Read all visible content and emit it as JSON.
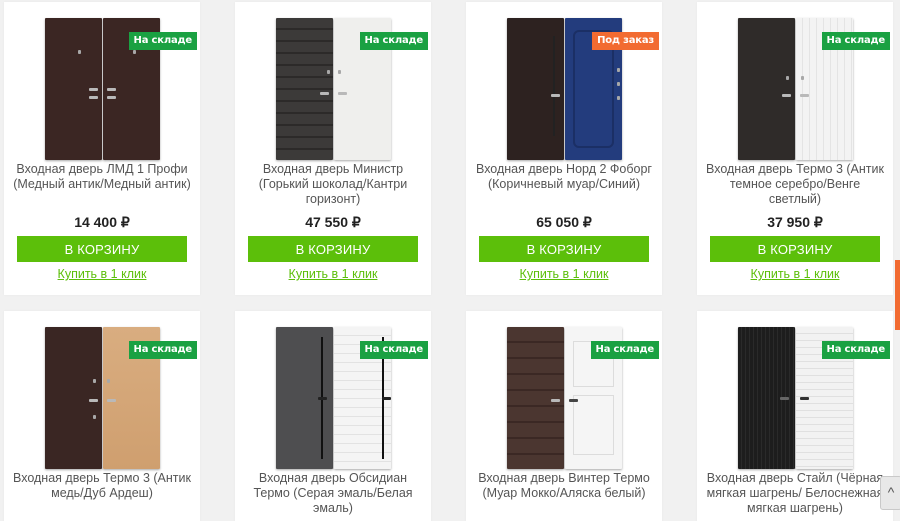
{
  "products": [
    {
      "title": "Входная дверь ЛМД 1 Профи (Медный антик/Медный антик)",
      "price": "14 400 ₽",
      "badge": "На складе",
      "badge_color": "#1aa142",
      "left_color": "#3b2623",
      "right_color": "#3b2623"
    },
    {
      "title": "Входная дверь Министр (Горький шоколад/Кантри горизонт)",
      "price": "47 550 ₽",
      "badge": "На складе",
      "badge_color": "#1aa142",
      "left_color": "#3c3a39",
      "right_color": "#efefed"
    },
    {
      "title": "Входная дверь Норд 2 Фоборг (Коричневый муар/Синий)",
      "price": "65 050 ₽",
      "badge": "Под заказ",
      "badge_color": "#f26b31",
      "left_color": "#2d2220",
      "right_color": "#233c7d"
    },
    {
      "title": "Входная дверь Термо 3 (Антик темное серебро/Венге светлый)",
      "price": "37 950 ₽",
      "badge": "На складе",
      "badge_color": "#1aa142",
      "left_color": "#2f2b29",
      "right_color": "#f3f3f3"
    },
    {
      "title": "Входная дверь Термо 3 (Антик медь/Дуб Ардеш)",
      "price": "",
      "badge": "На складе",
      "badge_color": "#1aa142",
      "left_color": "#3a2623",
      "right_color": "#d4a778"
    },
    {
      "title": "Входная дверь Обсидиан Термо (Серая эмаль/Белая эмаль)",
      "price": "",
      "badge": "На складе",
      "badge_color": "#1aa142",
      "left_color": "#4e4e50",
      "right_color": "#f4f4f4"
    },
    {
      "title": "Входная дверь Винтер Термо (Муар Мокко/Аляска белый)",
      "price": "",
      "badge": "На складе",
      "badge_color": "#1aa142",
      "left_color": "#4b3630",
      "right_color": "#f5f5f5"
    },
    {
      "title": "Входная дверь Стайл (Чёрная мягкая шагрень/ Белоснежная мягкая шагрень)",
      "price": "",
      "badge": "На складе",
      "badge_color": "#1aa142",
      "left_color": "#1d1d1d",
      "right_color": "#f2f2f2"
    }
  ],
  "cart_label": "В КОРЗИНУ",
  "quick_label": "Купить в 1 клик",
  "scroll_up_label": "^",
  "accent": "#5cbf0a"
}
